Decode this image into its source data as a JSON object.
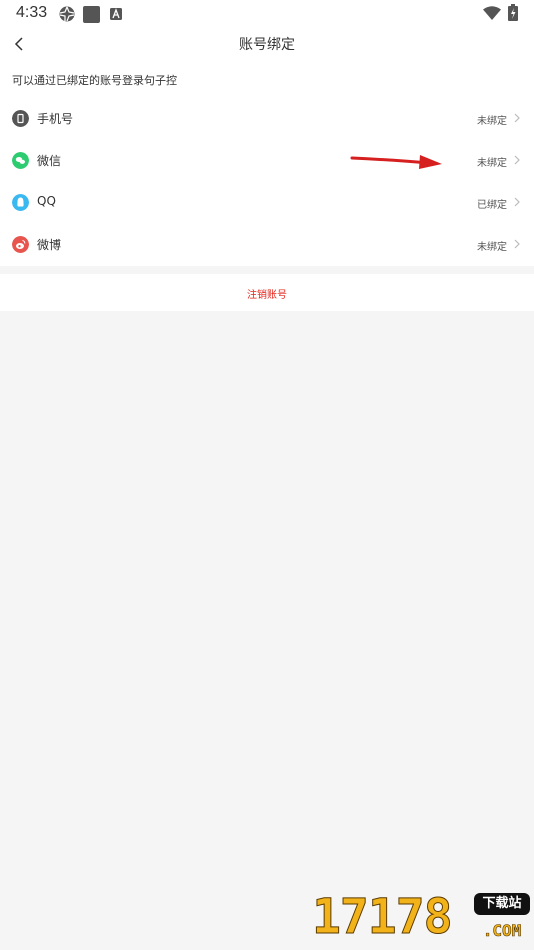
{
  "status_bar": {
    "time": "4:33",
    "icons": [
      "aperture-icon",
      "square-notification-icon",
      "a-badge-icon",
      "wifi-icon",
      "battery-charging-icon"
    ]
  },
  "header": {
    "title": "账号绑定"
  },
  "hint": "可以通过已绑定的账号登录句子控",
  "accounts": [
    {
      "label": "手机号",
      "status": "未绑定",
      "icon": "phone-icon",
      "color": "#555555"
    },
    {
      "label": "微信",
      "status": "未绑定",
      "icon": "wechat-icon",
      "color": "#2ecc71"
    },
    {
      "label": "QQ",
      "status": "已绑定",
      "icon": "qq-icon",
      "color": "#3ab8f0"
    },
    {
      "label": "微博",
      "status": "未绑定",
      "icon": "weibo-icon",
      "color": "#e8554e"
    }
  ],
  "cancel_label": "注销账号",
  "watermark": {
    "number": "17178",
    "badge": "下载站",
    "domain": ".COM"
  },
  "colors": {
    "accent_red": "#e2231a",
    "background": "#f5f5f5"
  }
}
